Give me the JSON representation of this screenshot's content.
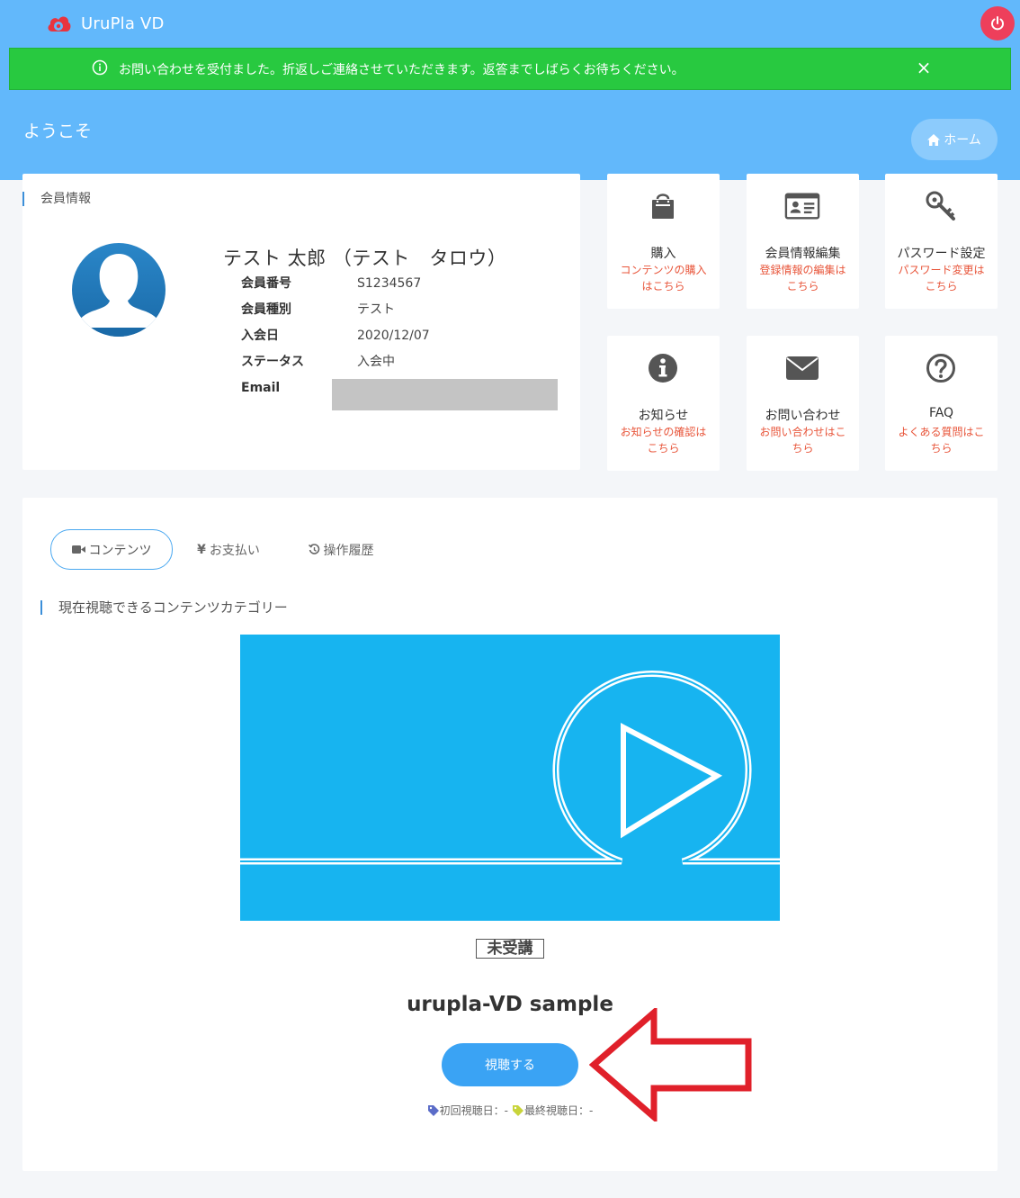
{
  "app": {
    "name": "UruPla VD"
  },
  "alert": {
    "message": "お問い合わせを受付ました。折返しご連絡させていただきます。返答までしばらくお待ちください。",
    "close": "×"
  },
  "header": {
    "welcome": "ようこそ",
    "home_label": "ホーム"
  },
  "member": {
    "section_title": "会員情報",
    "name": "テスト 太郎 （テスト　タロウ）",
    "fields": [
      {
        "label": "会員番号",
        "value": "S1234567"
      },
      {
        "label": "会員種別",
        "value": "テスト"
      },
      {
        "label": "入会日",
        "value": "2020/12/07"
      },
      {
        "label": "ステータス",
        "value": "入会中"
      },
      {
        "label": "Email",
        "value": ""
      }
    ]
  },
  "tiles": [
    {
      "title": "購入",
      "sub": "コンテンツの購入はこちら",
      "icon": "shopping-bag-icon"
    },
    {
      "title": "会員情報編集",
      "sub": "登録情報の編集はこちら",
      "icon": "id-card-icon"
    },
    {
      "title": "パスワード設定",
      "sub": "パスワード変更はこちら",
      "icon": "key-icon"
    },
    {
      "title": "お知らせ",
      "sub": "お知らせの確認はこちら",
      "icon": "info-icon"
    },
    {
      "title": "お問い合わせ",
      "sub": "お問い合わせはこちら",
      "icon": "envelope-icon"
    },
    {
      "title": "FAQ",
      "sub": "よくある質問はこちら",
      "icon": "question-icon"
    }
  ],
  "tabs": [
    {
      "label": "コンテンツ",
      "active": true
    },
    {
      "label": "お支払い",
      "active": false
    },
    {
      "label": "操作履歴",
      "active": false
    }
  ],
  "content": {
    "category_title": "現在視聴できるコンテンツカテゴリー",
    "badge": "未受講",
    "video_title": "urupla-VD sample",
    "watch_label": "視聴する",
    "first_view": "初回視聴日：-",
    "last_view": "最終視聴日：-"
  },
  "colors": {
    "header_bg": "#62b8fb",
    "alert_bg": "#28c940",
    "accent": "#3aa3f4",
    "link_red": "#e8553a",
    "power": "#ee3f5b"
  }
}
